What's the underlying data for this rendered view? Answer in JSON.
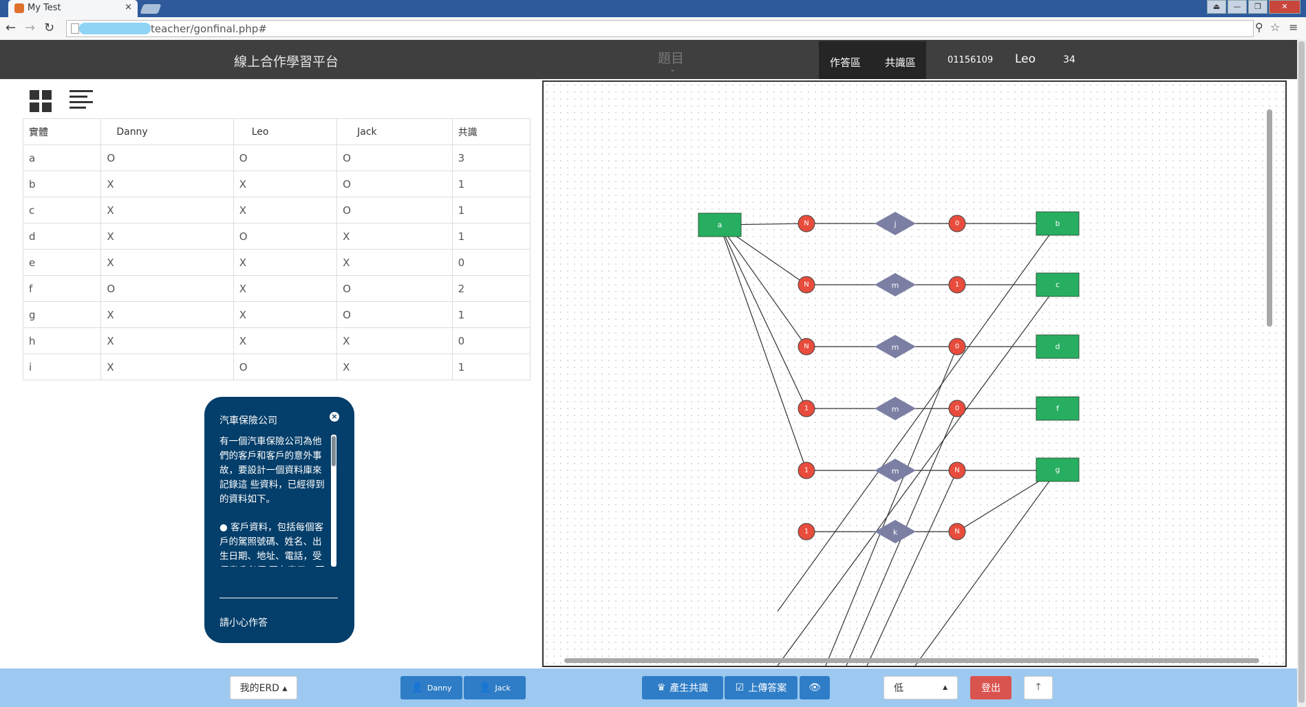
{
  "browser": {
    "tab_title": "My Test",
    "tab_close": "×",
    "url": "teacher/gonfinal.php#",
    "window_buttons": [
      "⏏",
      "—",
      "❐",
      "✕"
    ]
  },
  "header": {
    "platform_title": "線上合作學習平台",
    "topic_label": "題目",
    "topic_chevron": "⌄",
    "nav_work": "作答區",
    "nav_consensus": "共識區",
    "student_id": "01156109",
    "user_name": "Leo",
    "score": "34"
  },
  "table": {
    "headers": [
      "實體",
      "Danny",
      "Leo",
      "Jack",
      "共識"
    ],
    "rows": [
      [
        "a",
        "O",
        "O",
        "O",
        "3"
      ],
      [
        "b",
        "X",
        "X",
        "O",
        "1"
      ],
      [
        "c",
        "X",
        "X",
        "O",
        "1"
      ],
      [
        "d",
        "X",
        "O",
        "X",
        "1"
      ],
      [
        "e",
        "X",
        "X",
        "X",
        "0"
      ],
      [
        "f",
        "O",
        "X",
        "O",
        "2"
      ],
      [
        "g",
        "X",
        "X",
        "O",
        "1"
      ],
      [
        "h",
        "X",
        "X",
        "X",
        "0"
      ],
      [
        "i",
        "X",
        "O",
        "X",
        "1"
      ]
    ]
  },
  "popup": {
    "title": "汽車保險公司",
    "close_icon": "×",
    "paragraph1": "有一個汽車保險公司為他們的客戶和客戶的意外事故，要設計一個資料庫來記錄這 些資料，已經得到的資料如下。",
    "paragraph2": "● 客戶資料，包括每個客戶的駕照號碼、姓名、出生日期、地址、電話，受保客戶必須 要有車子，否則不能購買",
    "footer": "請小心作答"
  },
  "erd": {
    "colors": {
      "entity": "#27ae60",
      "relationship": "#7b7fa3",
      "cardinality": "#e74c3c"
    },
    "entities": [
      "a",
      "b",
      "c",
      "d",
      "f",
      "g"
    ],
    "relationships": [
      "j",
      "m",
      "m",
      "m",
      "m",
      "k"
    ],
    "left_cardinalities": [
      "N",
      "N",
      "N",
      "1",
      "1",
      "1"
    ],
    "right_cardinalities": [
      "0",
      "1",
      "0",
      "0",
      "N",
      "N"
    ]
  },
  "footer": {
    "my_erd": "我的ERD ▴",
    "user1": "Danny",
    "user2": "Jack",
    "generate": "產生共識",
    "upload": "上傳答案",
    "level": "低",
    "logout": "登出",
    "up_arrow": "🡑"
  }
}
